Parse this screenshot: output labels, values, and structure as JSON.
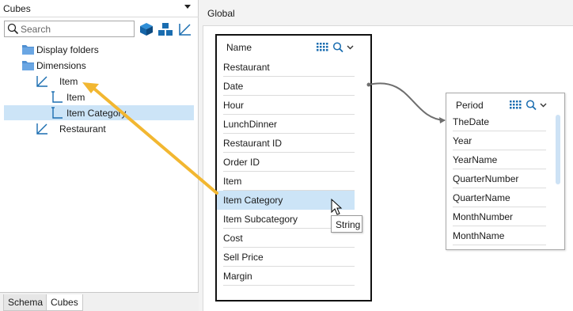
{
  "left_panel": {
    "title": "Cubes",
    "search": {
      "placeholder": "Search",
      "value": ""
    },
    "tree": [
      {
        "label": "Display folders"
      },
      {
        "label": "Dimensions"
      },
      {
        "label": "Item"
      },
      {
        "label": "Item"
      },
      {
        "label": "Item Category"
      },
      {
        "label": "Restaurant"
      }
    ],
    "tabs": [
      {
        "label": "Schema"
      },
      {
        "label": "Cubes"
      }
    ]
  },
  "canvas": {
    "title": "Global",
    "main_table": {
      "header": "Name",
      "fields": [
        "Restaurant",
        "Date",
        "Hour",
        "LunchDinner",
        "Restaurant ID",
        "Order ID",
        "Item",
        "Item Category",
        "Item Subcategory",
        "Cost",
        "Sell Price",
        "Margin"
      ]
    },
    "period_table": {
      "header": "Period",
      "fields": [
        "TheDate",
        "Year",
        "YearName",
        "QuarterNumber",
        "QuarterName",
        "MonthNumber",
        "MonthName"
      ]
    },
    "tooltip": "String"
  },
  "colors": {
    "selection": "#cce4f7",
    "accent_blue": "#1a6db0",
    "arrow": "#f2b731",
    "folder": "#4f8fd1"
  }
}
